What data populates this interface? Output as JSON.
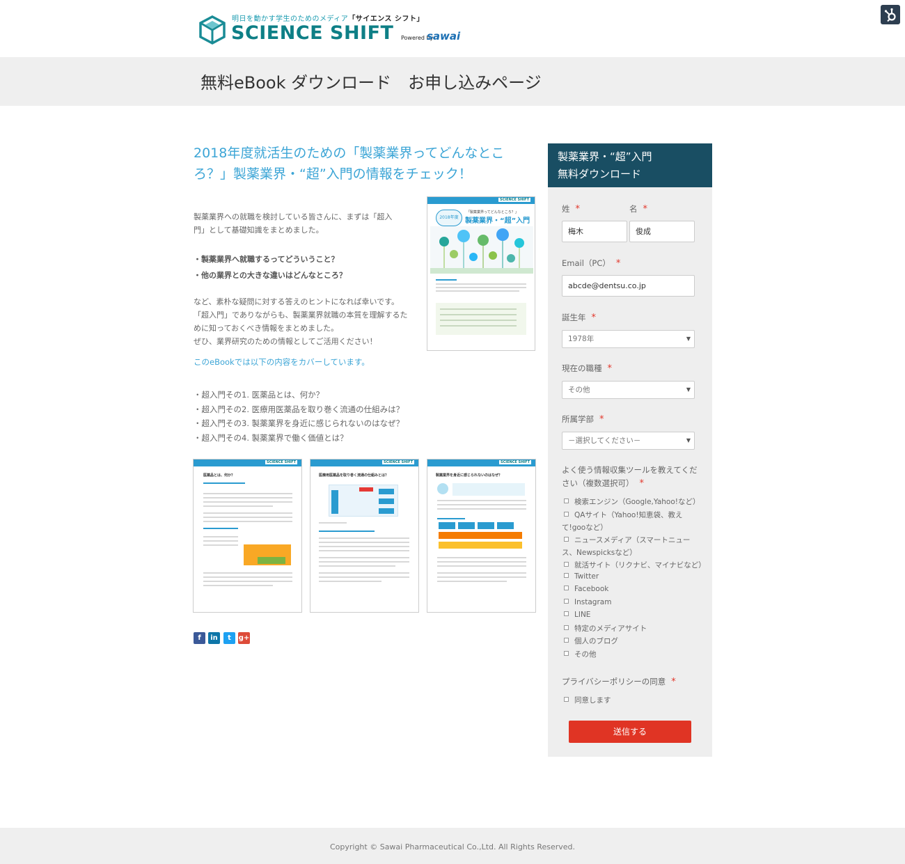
{
  "header": {
    "tagline_prefix": "明日を動かす学生のためのメディア",
    "tagline_name": "「サイエンス シフト」",
    "logo_text": "SCIENCE SHIFT",
    "powered_by": "Powered by",
    "brand": "sawai",
    "hubspot_icon": "sprocket-icon"
  },
  "banner": {
    "title": "無料eBook ダウンロード　お申し込みページ"
  },
  "content": {
    "title": "2018年度就活生のための「製薬業界ってどんなところ？」製薬業界・“超”入門の情報をチェック！",
    "intro": "製薬業界への就職を検討している皆さんに、まずは「超入門」として基礎知識をまとめました。",
    "questions": [
      "・製薬業界へ就職するってどういうこと？",
      "・他の業界との大きな違いはどんなところ？"
    ],
    "para2": [
      "など、素朴な疑問に対する答えのヒントになれば幸いです。",
      "「超入門」でありながらも、製薬業界就職の本質を理解するために知っておくべき情報をまとめました。",
      "ぜひ、業界研究のための情報としてご活用ください！"
    ],
    "cover_note": "このeBookでは以下の内容をカバーしています。",
    "chapters": [
      "・超入門その1. 医薬品とは、何か？",
      "・超入門その2. 医療用医薬品を取り巻く流通の仕組みは？",
      "・超入門その3. 製薬業界を身近に感じられないのはなぜ？",
      "・超入門その4. 製薬業界で働く価値とは？"
    ],
    "cover_thumb": {
      "top_text": "「製薬業界ってどんなところ？」",
      "badge": "2018年度",
      "title": "製薬業界・“超”入門"
    },
    "page_thumbs": [
      {
        "heading": "医薬品とは、何か？"
      },
      {
        "heading": "医療用医薬品を取り巻く流通の仕組みとは？"
      },
      {
        "heading": "製薬業界を身近に感じられないのはなぜ？"
      }
    ],
    "social": [
      {
        "icon": "facebook-icon",
        "glyph": "f",
        "color": "#3b5998"
      },
      {
        "icon": "linkedin-icon",
        "glyph": "in",
        "color": "#0e76a8"
      },
      {
        "icon": "twitter-icon",
        "glyph": "t",
        "color": "#1da1f2"
      },
      {
        "icon": "googleplus-icon",
        "glyph": "g+",
        "color": "#dd4b39"
      }
    ]
  },
  "form": {
    "head_line1": "製薬業界・“超”入門",
    "head_line2": "無料ダウンロード",
    "required_mark": "*",
    "last_name_label": "姓",
    "first_name_label": "名",
    "last_name_value": "梅木",
    "first_name_value": "俊成",
    "email_label": "Email（PC）",
    "email_value": "abcde@dentsu.co.jp",
    "birth_year_label": "誕生年",
    "birth_year_value": "1978年",
    "job_label": "現在の職種",
    "job_value": "その他",
    "faculty_label": "所属学部",
    "faculty_value": "－選択してください－",
    "tools_label": "よく使う情報収集ツールを教えてください（複数選択可）",
    "tools": [
      "検索エンジン（Google,Yahoo!など）",
      "QAサイト（Yahoo!知恵袋、教えて!gooなど）",
      "ニュースメディア（スマートニュース、Newspicksなど）",
      "就活サイト（リクナビ、マイナビなど）",
      "Twitter",
      "Facebook",
      "Instagram",
      "LINE",
      "特定のメディアサイト",
      "個人のブログ",
      "その他"
    ],
    "privacy_label": "プライバシーポリシーの同意",
    "privacy_option": "同意します",
    "submit_label": "送信する"
  },
  "footer": {
    "copyright": "Copyright © Sawai Pharmaceutical Co.,Ltd. All Rights Reserved."
  }
}
